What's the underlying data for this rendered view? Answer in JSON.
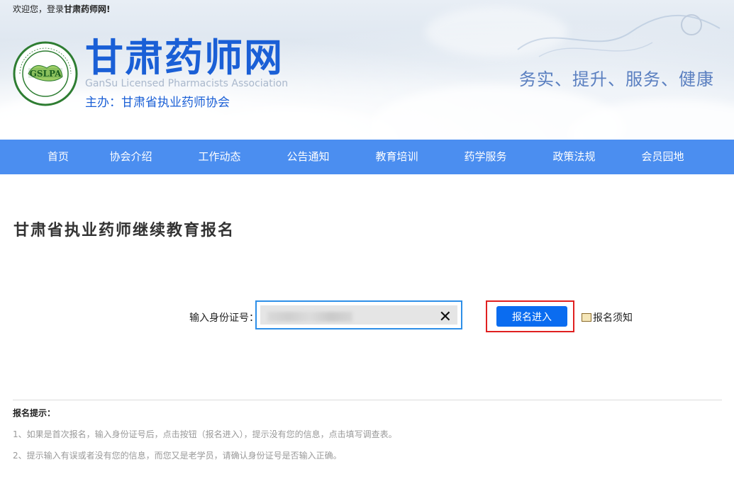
{
  "header": {
    "welcome_prefix": "欢迎您，登录",
    "welcome_site": "甘肃药师网!",
    "logo_text": "GSLPA",
    "site_title": "甘肃药师网",
    "site_en": "GanSu Licensed Pharmacists Association",
    "host": "主办：甘肃省执业药师协会",
    "slogan": "务实、提升、服务、健康"
  },
  "nav": {
    "items": [
      "首页",
      "协会介绍",
      "工作动态",
      "公告通知",
      "教育培训",
      "药学服务",
      "政策法规",
      "会员园地"
    ]
  },
  "main": {
    "title": "甘肃省执业药师继续教育报名",
    "id_label": "输入身份证号：",
    "clear_symbol": "✕",
    "submit_label": "报名进入",
    "notice_label": "报名须知"
  },
  "tips": {
    "title": "报名提示：",
    "items": [
      "1、如果是首次报名，输入身份证号后，点击按钮（报名进入），提示没有您的信息，点击填写调查表。",
      "2、提示输入有误或者没有您的信息，而您又是老学员，请确认身份证号是否输入正确。"
    ]
  },
  "colors": {
    "nav_bg": "#4b8ef0",
    "brand_blue": "#1a5fd6",
    "button_blue": "#0a6cf0",
    "highlight_red": "#e02020",
    "input_border": "#2e8fe8"
  }
}
